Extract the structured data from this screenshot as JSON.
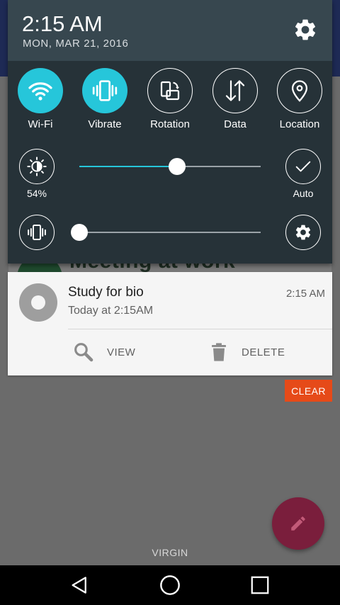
{
  "status": {
    "time": "2:15 AM",
    "date": "MON, MAR 21, 2016"
  },
  "quick_tiles": [
    {
      "label": "Wi-Fi",
      "icon": "wifi-icon",
      "active": true
    },
    {
      "label": "Vibrate",
      "icon": "vibrate-icon",
      "active": true
    },
    {
      "label": "Rotation",
      "icon": "rotation-icon",
      "active": false
    },
    {
      "label": "Data",
      "icon": "data-icon",
      "active": false
    },
    {
      "label": "Location",
      "icon": "location-icon",
      "active": false
    }
  ],
  "brightness": {
    "value_label": "54%",
    "slider_fraction": 0.54,
    "auto_label": "Auto"
  },
  "volume": {
    "slider_fraction": 0.0
  },
  "background_app": {
    "peek_text": "Meeting at work"
  },
  "notification": {
    "title": "Study for bio",
    "time": "2:15 AM",
    "text": "Today at 2:15AM",
    "actions": [
      {
        "label": "VIEW",
        "icon": "search-icon"
      },
      {
        "label": "DELETE",
        "icon": "trash-icon"
      }
    ]
  },
  "clear_label": "CLEAR",
  "carrier": "VIRGIN",
  "colors": {
    "accent": "#26c6da",
    "shade": "#263238",
    "shade_header": "#37474f",
    "clear_button": "#e64a19",
    "fab": "#7a1e3c"
  }
}
